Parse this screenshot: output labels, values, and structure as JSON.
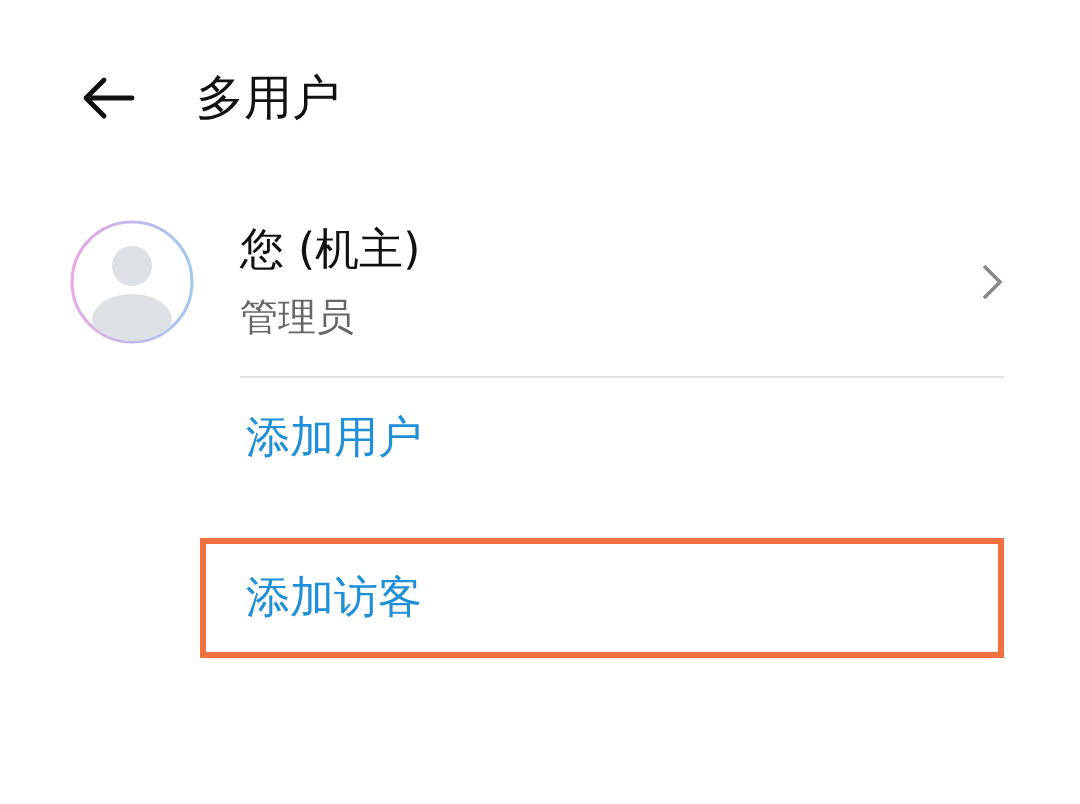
{
  "header": {
    "title": "多用户"
  },
  "current_user": {
    "name": "您 (机主)",
    "role": "管理员"
  },
  "actions": [
    {
      "label": "添加用户",
      "highlighted": false
    },
    {
      "label": "添加访客",
      "highlighted": true
    }
  ]
}
